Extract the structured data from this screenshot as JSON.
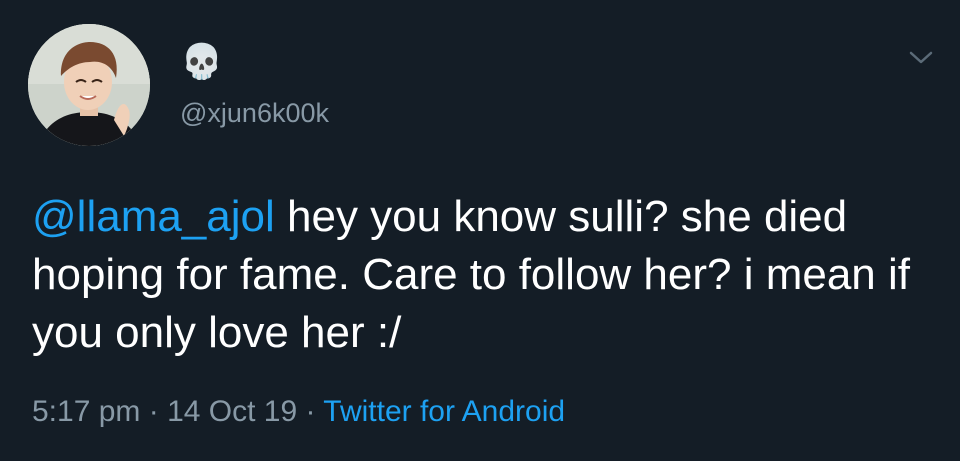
{
  "author": {
    "display_name": "💀",
    "handle": "@xjun6k00k"
  },
  "tweet": {
    "mention": "@llama_ajol",
    "text": " hey you know sulli? she died hoping for fame. Care to follow her? i mean if you only love her :/"
  },
  "meta": {
    "time": "5:17 pm",
    "separator": " · ",
    "date": "14 Oct 19",
    "source": "Twitter for Android"
  },
  "icons": {
    "menu": "chevron-down-icon",
    "avatar": "avatar"
  },
  "colors": {
    "background": "#141d26",
    "link": "#1da1f2",
    "secondary_text": "#8899a6",
    "primary_text": "#ffffff"
  }
}
